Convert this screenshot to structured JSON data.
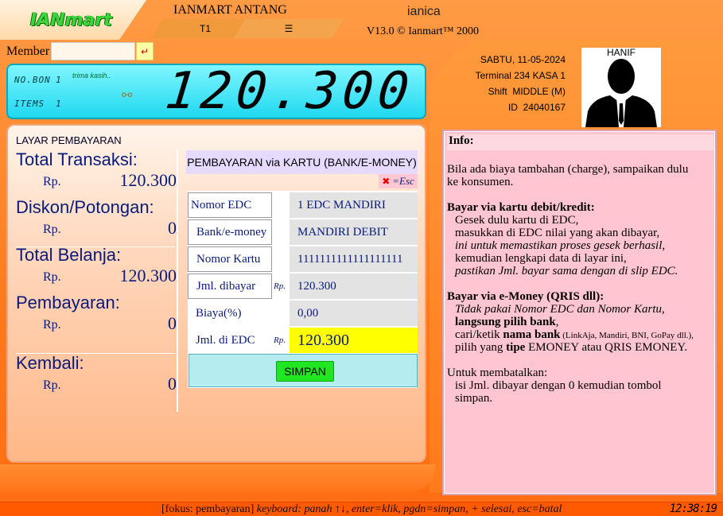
{
  "header": {
    "logo": "IANmart",
    "store_name": "IANMART ANTANG",
    "tabs": [
      "T1",
      "☰"
    ],
    "user": "ianica",
    "version": "V13.0 © Ianmart™ 2000"
  },
  "member": {
    "label": "Member",
    "value": "",
    "enter_icon": "↵"
  },
  "display": {
    "nobon_label": "NO.BON",
    "nobon_value": "1",
    "items_label": "ITEMS",
    "items_value": "1",
    "thanks": "trima kasih..",
    "bag_icon": "money-bag-icon",
    "amount": "120.300"
  },
  "payment_panel": {
    "title": "LAYAR PEMBAYARAN",
    "summary": [
      {
        "label": "Total Transaksi:",
        "currency": "Rp.",
        "value": "120.300"
      },
      {
        "label": "Diskon/Potongan:",
        "currency": "Rp.",
        "value": "0"
      },
      {
        "label": "Total Belanja:",
        "currency": "Rp.",
        "value": "120.300"
      },
      {
        "label": "Pembayaran:",
        "currency": "Rp.",
        "value": "0"
      },
      {
        "label": "Kembali:",
        "currency": "Rp.",
        "value": "0"
      }
    ],
    "form_title": "PEMBAYARAN via KARTU (BANK/E-MONEY)",
    "esc_icon": "close-icon",
    "esc_label": "=Esc",
    "fields": [
      {
        "label": "Nomor EDC",
        "currency": "",
        "value": "1 EDC MANDIRI"
      },
      {
        "label": "Bank/e-money",
        "currency": "",
        "value": "MANDIRI DEBIT"
      },
      {
        "label": "Nomor Kartu",
        "currency": "",
        "value": "1111111111111111111"
      },
      {
        "label": "Jml. dibayar",
        "currency": "Rp.",
        "value": "120.300"
      },
      {
        "label": "Biaya(%)",
        "currency": "",
        "value": "0,00"
      },
      {
        "label": "Jml. di EDC",
        "currency": "Rp.",
        "value": "120.300"
      }
    ],
    "save_label": "SIMPAN"
  },
  "cashier": {
    "date": "SABTU, 11-05-2024",
    "terminal": "Terminal 234 KASA 1",
    "shift": "Shift  MIDDLE (M)",
    "id": "ID  24040167",
    "name": "HANIF"
  },
  "info": {
    "title": "Info:",
    "intro": [
      "Bila ada biaya tambahan (charge), sampaikan dulu",
      "ke konsumen."
    ],
    "debit_title": "Bayar via kartu debit/kredit:",
    "debit_lines": [
      "Gesek dulu kartu di EDC,",
      "masukkan di EDC nilai yang akan dibayar,",
      "ini untuk memastikan proses gesek berhasil,",
      "kemudian lengkapi data di layar ini,",
      "pastikan Jml. bayar sama dengan di slip EDC."
    ],
    "emoney_title": "Bayar via e-Money (QRIS dll):",
    "emoney_l1": "Tidak pakai Nomor EDC dan Nomor Kartu,",
    "emoney_l2a": "langsung pilih bank",
    "emoney_l2b": ",",
    "emoney_l3a": "cari/ketik ",
    "emoney_l3b": "nama bank",
    "emoney_l3c": " (LinkAja, Mandiri, BNI, GoPay dll.),",
    "emoney_l4a": "pilih yang ",
    "emoney_l4b": "tipe",
    "emoney_l4c": " EMONEY atau QRIS EMONEY.",
    "cancel_title": "Untuk membatalkan:",
    "cancel_lines": [
      "isi Jml. dibayar dengan 0 kemudian tombol",
      "simpan."
    ]
  },
  "status_bar": {
    "focus": "[fokus: pembayaran]",
    "hint": " keyboard: panah ↑↓, enter=klik, pgdn=simpan, + selesai, esc=batal",
    "clock": "12:38:19"
  },
  "colors": {
    "accent_orange": "#ff7a1c",
    "display_cyan": "#1fd8f0",
    "info_pink": "#ffc6d2",
    "save_green": "#22e622",
    "highlight_yellow": "#ffff00",
    "text_navy": "#0a1a7a"
  }
}
